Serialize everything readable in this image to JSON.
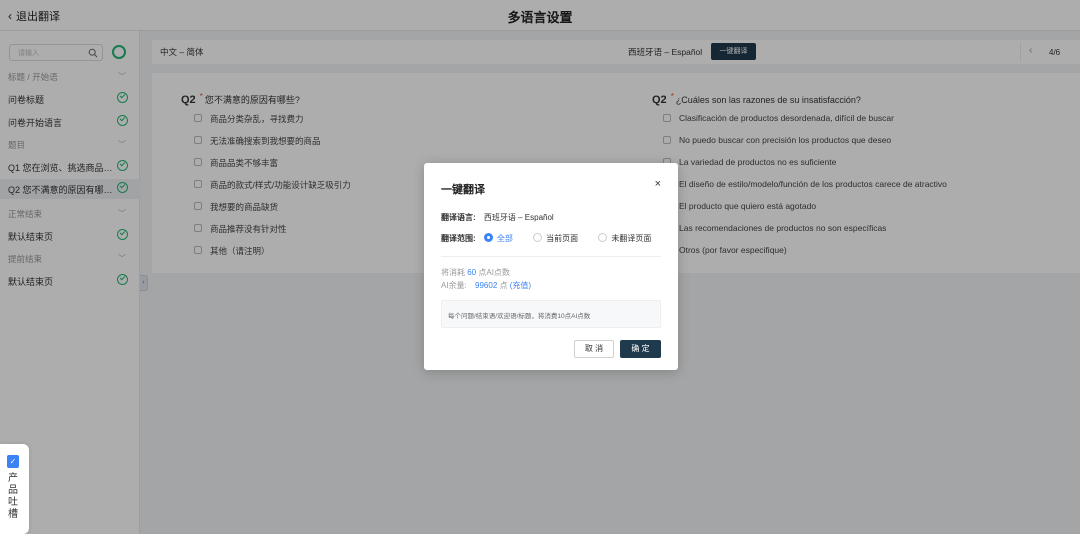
{
  "header": {
    "back_label": "退出翻译",
    "title": "多语言设置"
  },
  "sidebar": {
    "search_placeholder": "请输入",
    "rows": [
      {
        "kind": "group",
        "label": "标题 / 开始语"
      },
      {
        "kind": "item",
        "label": "问卷标题"
      },
      {
        "kind": "item",
        "label": "问卷开始语言"
      },
      {
        "kind": "group",
        "label": "题目"
      },
      {
        "kind": "item",
        "label": "Q1 您在浏览、挑选商品的..."
      },
      {
        "kind": "item",
        "label": "Q2 您不满意的原因有哪些?",
        "active": true
      },
      {
        "kind": "group",
        "label": "正常结束"
      },
      {
        "kind": "item",
        "label": "默认结束页"
      },
      {
        "kind": "group",
        "label": "提前结束"
      },
      {
        "kind": "item",
        "label": "默认结束页"
      }
    ]
  },
  "toolbar": {
    "source_lang": "中文 – 简体",
    "target_lang": "西班牙语 – Español",
    "one_click_label": "一键翻译",
    "page_indicator": "4/6"
  },
  "question_left": {
    "number": "Q2",
    "title": "您不满意的原因有哪些?",
    "options": [
      "商品分类杂乱，寻找费力",
      "无法准确搜索到我想要的商品",
      "商品品类不够丰富",
      "商品的款式/样式/功能设计缺乏吸引力",
      "我想要的商品缺货",
      "商品推荐没有针对性",
      "其他（请注明）"
    ]
  },
  "question_right": {
    "number": "Q2",
    "title": "¿Cuáles son las razones de su insatisfacción?",
    "options": [
      "Clasificación de productos desordenada, difícil de buscar",
      "No puedo buscar con precisión los productos que deseo",
      "La variedad de productos no es suficiente",
      "El diseño de estilo/modelo/función de los productos carece de atractivo",
      "El producto que quiero está agotado",
      "Las recomendaciones de productos no son específicas",
      "Otros (por favor especifique)"
    ]
  },
  "feedback": {
    "label": "产品吐槽"
  },
  "modal": {
    "title": "一键翻译",
    "close_glyph": "×",
    "lang_key": "翻译语言:",
    "lang_value": "西班牙语 – Español",
    "scope_key": "翻译范围:",
    "scope_options": [
      "全部",
      "当前页面",
      "未翻译页面"
    ],
    "cost_prefix": "将消耗",
    "cost_value": "60",
    "cost_suffix": "点AI点数",
    "balance_prefix": "AI余量:",
    "balance_value": "99602",
    "balance_unit": "点",
    "recharge_label": "(充值)",
    "note": "每个问题/结束语/欢迎语/标题，将消费10点AI点数",
    "cancel_label": "取 消",
    "ok_label": "确 定"
  }
}
